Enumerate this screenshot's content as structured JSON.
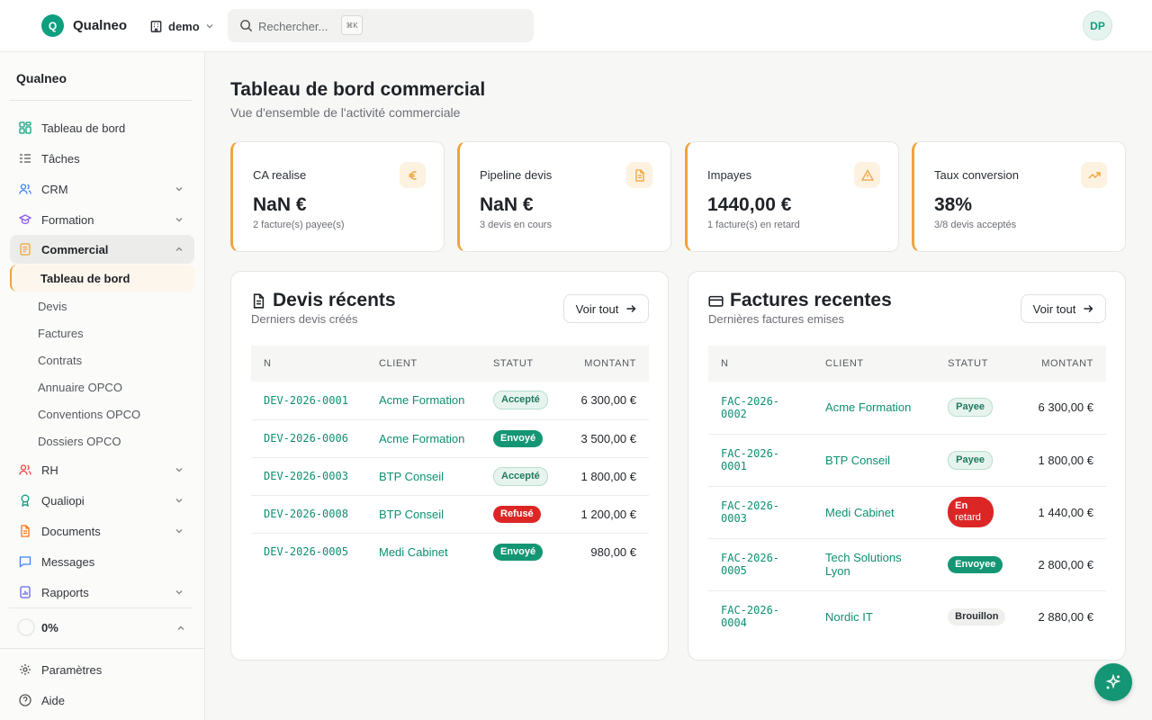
{
  "app": {
    "logo_letter": "Q",
    "name": "Qualneo",
    "org": "demo",
    "avatar_initials": "DP"
  },
  "search": {
    "placeholder": "Rechercher...",
    "shortcut": "⌘K"
  },
  "sidebar": {
    "title": "Qualneo",
    "items": [
      {
        "label": "Tableau de bord",
        "icon": "dashboard-icon"
      },
      {
        "label": "Tâches",
        "icon": "tasks-icon"
      },
      {
        "label": "CRM",
        "icon": "users-icon"
      },
      {
        "label": "Formation",
        "icon": "graduation-cap-icon"
      },
      {
        "label": "Commercial",
        "icon": "document-icon"
      },
      {
        "label": "RH",
        "icon": "people-icon"
      },
      {
        "label": "Qualiopi",
        "icon": "award-icon"
      },
      {
        "label": "Documents",
        "icon": "file-icon"
      },
      {
        "label": "Messages",
        "icon": "message-icon"
      },
      {
        "label": "Rapports",
        "icon": "report-icon"
      }
    ],
    "commercial_sub": [
      "Tableau de bord",
      "Devis",
      "Factures",
      "Contrats",
      "Annuaire OPCO",
      "Conventions OPCO",
      "Dossiers OPCO"
    ],
    "progress": "0%",
    "settings": "Paramètres",
    "help": "Aide"
  },
  "page": {
    "title": "Tableau de bord commercial",
    "subtitle": "Vue d'ensemble de l'activité commerciale"
  },
  "kpis": [
    {
      "label": "CA realise",
      "value": "NaN €",
      "sub": "2 facture(s) payee(s)",
      "icon": "euro-icon"
    },
    {
      "label": "Pipeline devis",
      "value": "NaN €",
      "sub": "3 devis en cours",
      "icon": "file-text-icon"
    },
    {
      "label": "Impayes",
      "value": "1440,00 €",
      "sub": "1 facture(s) en retard",
      "icon": "warning-icon"
    },
    {
      "label": "Taux conversion",
      "value": "38%",
      "sub": "3/8 devis acceptés",
      "icon": "trending-up-icon"
    }
  ],
  "quotes": {
    "title": "Devis récents",
    "subtitle": "Derniers devis créés",
    "button": "Voir tout",
    "columns": [
      "N",
      "CLIENT",
      "STATUT",
      "MONTANT"
    ],
    "rows": [
      {
        "n": "DEV-2026-0001",
        "client": "Acme Formation",
        "status": "Accepté",
        "amount": "6 300,00 €"
      },
      {
        "n": "DEV-2026-0006",
        "client": "Acme Formation",
        "status": "Envoyé",
        "amount": "3 500,00 €"
      },
      {
        "n": "DEV-2026-0003",
        "client": "BTP Conseil",
        "status": "Accepté",
        "amount": "1 800,00 €"
      },
      {
        "n": "DEV-2026-0008",
        "client": "BTP Conseil",
        "status": "Refusé",
        "amount": "1 200,00 €"
      },
      {
        "n": "DEV-2026-0005",
        "client": "Medi Cabinet",
        "status": "Envoyé",
        "amount": "980,00 €"
      }
    ]
  },
  "invoices": {
    "title": "Factures recentes",
    "subtitle": "Dernières factures emises",
    "button": "Voir tout",
    "columns": [
      "N",
      "CLIENT",
      "STATUT",
      "MONTANT"
    ],
    "rows": [
      {
        "n1": "FAC-2026-",
        "n2": "0002",
        "client1": "Acme Formation",
        "client2": "",
        "status1": "Payee",
        "status2": "",
        "amount": "6 300,00 €"
      },
      {
        "n1": "FAC-2026-",
        "n2": "0001",
        "client1": "BTP Conseil",
        "client2": "",
        "status1": "Payee",
        "status2": "",
        "amount": "1 800,00 €"
      },
      {
        "n1": "FAC-2026-",
        "n2": "0003",
        "client1": "Medi Cabinet",
        "client2": "",
        "status1": "En",
        "status2": "retard",
        "amount": "1 440,00 €"
      },
      {
        "n1": "FAC-2026-",
        "n2": "0005",
        "client1": "Tech Solutions",
        "client2": "Lyon",
        "status1": "Envoyee",
        "status2": "",
        "amount": "2 800,00 €"
      },
      {
        "n1": "FAC-2026-",
        "n2": "0004",
        "client1": "Nordic IT",
        "client2": "",
        "status1": "Brouillon",
        "status2": "",
        "amount": "2 880,00 €"
      }
    ]
  },
  "colors": {
    "brand": "#0e9f7e",
    "accent": "#f0a43a",
    "danger": "#dc2626"
  }
}
